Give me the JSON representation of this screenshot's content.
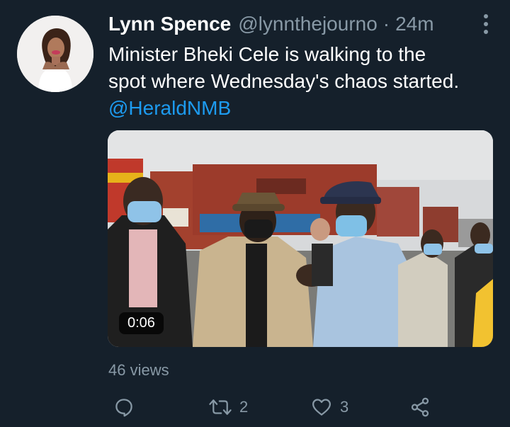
{
  "tweet": {
    "author_name": "Lynn Spence",
    "author_handle": "@lynnthejourno",
    "separator": "·",
    "time": "24m",
    "text_line1": "Minister Bheki Cele is walking to the",
    "text_line2": "spot where Wednesday's chaos started.",
    "mention": "@HeraldNMB",
    "video_duration": "0:06",
    "views": "46 views",
    "reply_count": "",
    "retweet_count": "2",
    "like_count": "3"
  },
  "icons": {
    "more": "more-vertical-icon",
    "reply": "reply-icon",
    "retweet": "retweet-icon",
    "like": "heart-icon",
    "share": "share-icon"
  },
  "colors": {
    "background": "#15202b",
    "muted_text": "#8899a6",
    "link": "#1d9bf0"
  }
}
